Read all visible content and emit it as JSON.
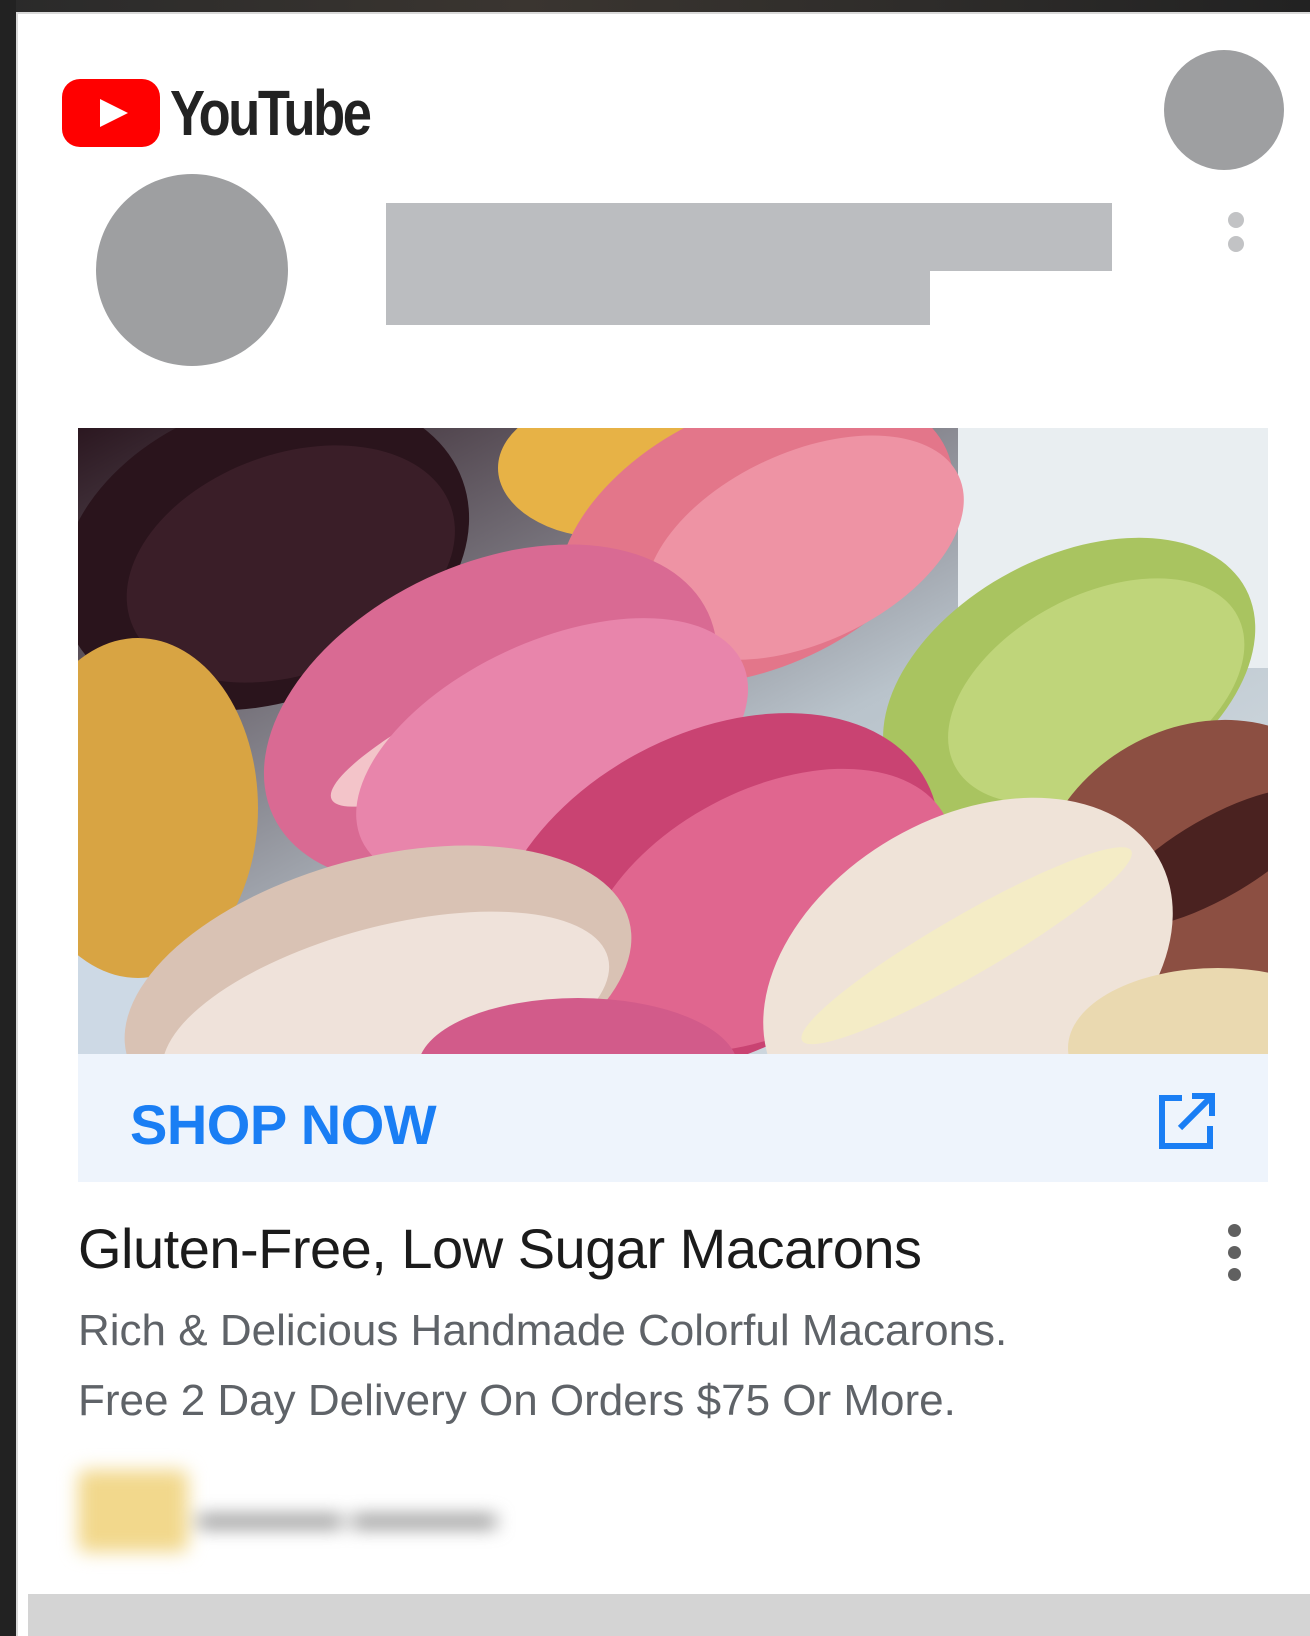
{
  "header": {
    "logo_text": "YouTube",
    "logo_icon": "youtube-play-icon",
    "avatar": "account-avatar-placeholder"
  },
  "ad": {
    "image_alt": "macarons-photo",
    "cta_label": "SHOP NOW",
    "cta_icon": "open-in-new-icon",
    "title": "Gluten-Free, Low Sugar Macarons",
    "menu_icon": "more-vert-icon",
    "description_line1": "Rich & Delicious Handmade Colorful Macarons.",
    "description_line2": "Free 2 Day Delivery On Orders $75 Or More."
  },
  "colors": {
    "brand_red": "#ff0000",
    "cta_blue": "#1a7ef4",
    "cta_bg": "#eef4fc",
    "placeholder_gray": "#9e9fa1"
  }
}
